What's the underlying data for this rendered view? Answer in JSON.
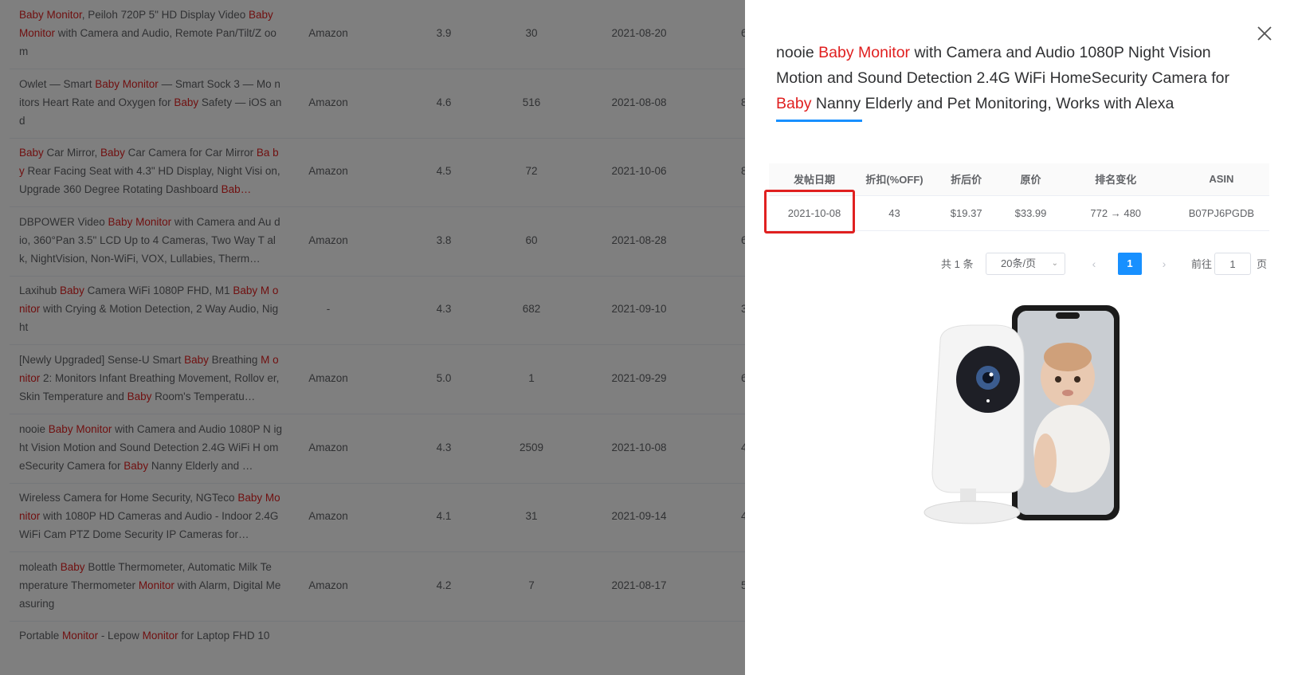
{
  "background_table": {
    "rows": [
      {
        "title_parts": [
          {
            "t": "Baby Monitor",
            "h": true
          },
          {
            "t": ", Peiloh 720P 5\" HD Display Video ",
            "h": false
          },
          {
            "t": "Bab",
            "h": true
          }
        ],
        "title_rest": [
          {
            "t": "y Monitor",
            "h": true
          },
          {
            "t": " with Camera and Audio, Remote Pan/Tilt/Z oom",
            "h": false
          }
        ],
        "source": "Amazon",
        "rating": "3.9",
        "reviews": "30",
        "date": "2021-08-20",
        "extra": "6"
      },
      {
        "title_parts": [
          {
            "t": "Owlet — Smart ",
            "h": false
          },
          {
            "t": "Baby Monitor",
            "h": true
          },
          {
            "t": " — Smart Sock 3 — Mo nitors Heart Rate and Oxygen for ",
            "h": false
          },
          {
            "t": "Baby",
            "h": true
          },
          {
            "t": " Safety — iOS and",
            "h": false
          }
        ],
        "title_rest": [],
        "source": "Amazon",
        "rating": "4.6",
        "reviews": "516",
        "date": "2021-08-08",
        "extra": "8"
      },
      {
        "title_parts": [
          {
            "t": "Baby",
            "h": true
          },
          {
            "t": " Car Mirror, ",
            "h": false
          },
          {
            "t": "Baby",
            "h": true
          },
          {
            "t": " Car Camera for Car Mirror ",
            "h": false
          },
          {
            "t": "Ba by",
            "h": true
          },
          {
            "t": " Rear Facing Seat with 4.3\" HD Display, Night Visi on, Upgrade 360 Degree Rotating Dashboard ",
            "h": false
          },
          {
            "t": "Bab…",
            "h": true
          }
        ],
        "title_rest": [],
        "source": "Amazon",
        "rating": "4.5",
        "reviews": "72",
        "date": "2021-10-06",
        "extra": "8"
      },
      {
        "title_parts": [
          {
            "t": "DBPOWER Video ",
            "h": false
          },
          {
            "t": "Baby Monitor",
            "h": true
          },
          {
            "t": " with Camera and Au dio, 360°Pan 3.5\" LCD Up to 4 Cameras, Two Way T alk, NightVision, Non-WiFi, VOX, Lullabies, Therm…",
            "h": false
          }
        ],
        "title_rest": [],
        "source": "Amazon",
        "rating": "3.8",
        "reviews": "60",
        "date": "2021-08-28",
        "extra": "6"
      },
      {
        "title_parts": [
          {
            "t": "Laxihub ",
            "h": false
          },
          {
            "t": "Baby",
            "h": true
          },
          {
            "t": " Camera WiFi 1080P FHD, M1 ",
            "h": false
          },
          {
            "t": "Baby M onitor",
            "h": true
          },
          {
            "t": " with Crying & Motion Detection, 2 Way Audio, Night",
            "h": false
          }
        ],
        "title_rest": [],
        "source": "-",
        "rating": "4.3",
        "reviews": "682",
        "date": "2021-09-10",
        "extra": "3"
      },
      {
        "title_parts": [
          {
            "t": "[Newly Upgraded] Sense-U Smart ",
            "h": false
          },
          {
            "t": "Baby",
            "h": true
          },
          {
            "t": " Breathing ",
            "h": false
          },
          {
            "t": "M onitor",
            "h": true
          },
          {
            "t": " 2: Monitors Infant Breathing Movement, Rollov er, Skin Temperature and ",
            "h": false
          },
          {
            "t": "Baby",
            "h": true
          },
          {
            "t": " Room's Temperatu…",
            "h": false
          }
        ],
        "title_rest": [],
        "source": "Amazon",
        "rating": "5.0",
        "reviews": "1",
        "date": "2021-09-29",
        "extra": "6"
      },
      {
        "title_parts": [
          {
            "t": "nooie ",
            "h": false
          },
          {
            "t": "Baby Monitor",
            "h": true
          },
          {
            "t": " with Camera and Audio 1080P N ight Vision Motion and Sound Detection 2.4G WiFi H omeSecurity Camera for ",
            "h": false
          },
          {
            "t": "Baby",
            "h": true
          },
          {
            "t": " Nanny Elderly and …",
            "h": false
          }
        ],
        "title_rest": [],
        "source": "Amazon",
        "rating": "4.3",
        "reviews": "2509",
        "date": "2021-10-08",
        "extra": "4"
      },
      {
        "title_parts": [
          {
            "t": "Wireless Camera for Home Security, NGTeco ",
            "h": false
          },
          {
            "t": "Baby Monitor",
            "h": true
          },
          {
            "t": " with 1080P HD Cameras and Audio - Indoor 2.4GWiFi Cam PTZ Dome Security IP Cameras for…",
            "h": false
          }
        ],
        "title_rest": [],
        "source": "Amazon",
        "rating": "4.1",
        "reviews": "31",
        "date": "2021-09-14",
        "extra": "4"
      },
      {
        "title_parts": [
          {
            "t": "moleath ",
            "h": false
          },
          {
            "t": "Baby",
            "h": true
          },
          {
            "t": " Bottle Thermometer, Automatic Milk Te mperature Thermometer ",
            "h": false
          },
          {
            "t": "Monitor",
            "h": true
          },
          {
            "t": " with Alarm, Digital Measuring",
            "h": false
          }
        ],
        "title_rest": [],
        "source": "Amazon",
        "rating": "4.2",
        "reviews": "7",
        "date": "2021-08-17",
        "extra": "5"
      },
      {
        "title_parts": [
          {
            "t": "Portable ",
            "h": false
          },
          {
            "t": "Monitor",
            "h": true
          },
          {
            "t": " - Lepow ",
            "h": false
          },
          {
            "t": "Monitor",
            "h": true
          },
          {
            "t": " for Laptop FHD 10",
            "h": false
          }
        ],
        "title_rest": [],
        "source": "",
        "rating": "",
        "reviews": "",
        "date": "",
        "extra": ""
      }
    ]
  },
  "drawer": {
    "title_parts": [
      {
        "t": "nooie ",
        "h": false
      },
      {
        "t": "Baby Monitor",
        "h": true
      },
      {
        "t": " with Camera and Audio 1080P Night Vision Motion and Sound Detection 2.4G WiFi HomeSecurity Camera for ",
        "h": false
      },
      {
        "t": "Baby",
        "h": true
      },
      {
        "t": " Nanny Elderly and Pet Monitoring, Works with Alexa",
        "h": false
      }
    ],
    "table": {
      "headers": [
        "发帖日期",
        "折扣(%OFF)",
        "折后价",
        "原价",
        "排名变化",
        "ASIN"
      ],
      "row": {
        "date": "2021-10-08",
        "discount": "43",
        "price_after": "$19.37",
        "price_orig": "$33.99",
        "rank_change": "772 → 480",
        "asin": "B07PJ6PGDB"
      }
    },
    "pagination": {
      "total": "共 1 条",
      "page_size": "20条/页",
      "current_page": "1",
      "goto_label": "前往",
      "goto_value": "1",
      "page_unit": "页"
    }
  },
  "colors": {
    "highlight": "#e02020",
    "accent": "#1890ff"
  }
}
